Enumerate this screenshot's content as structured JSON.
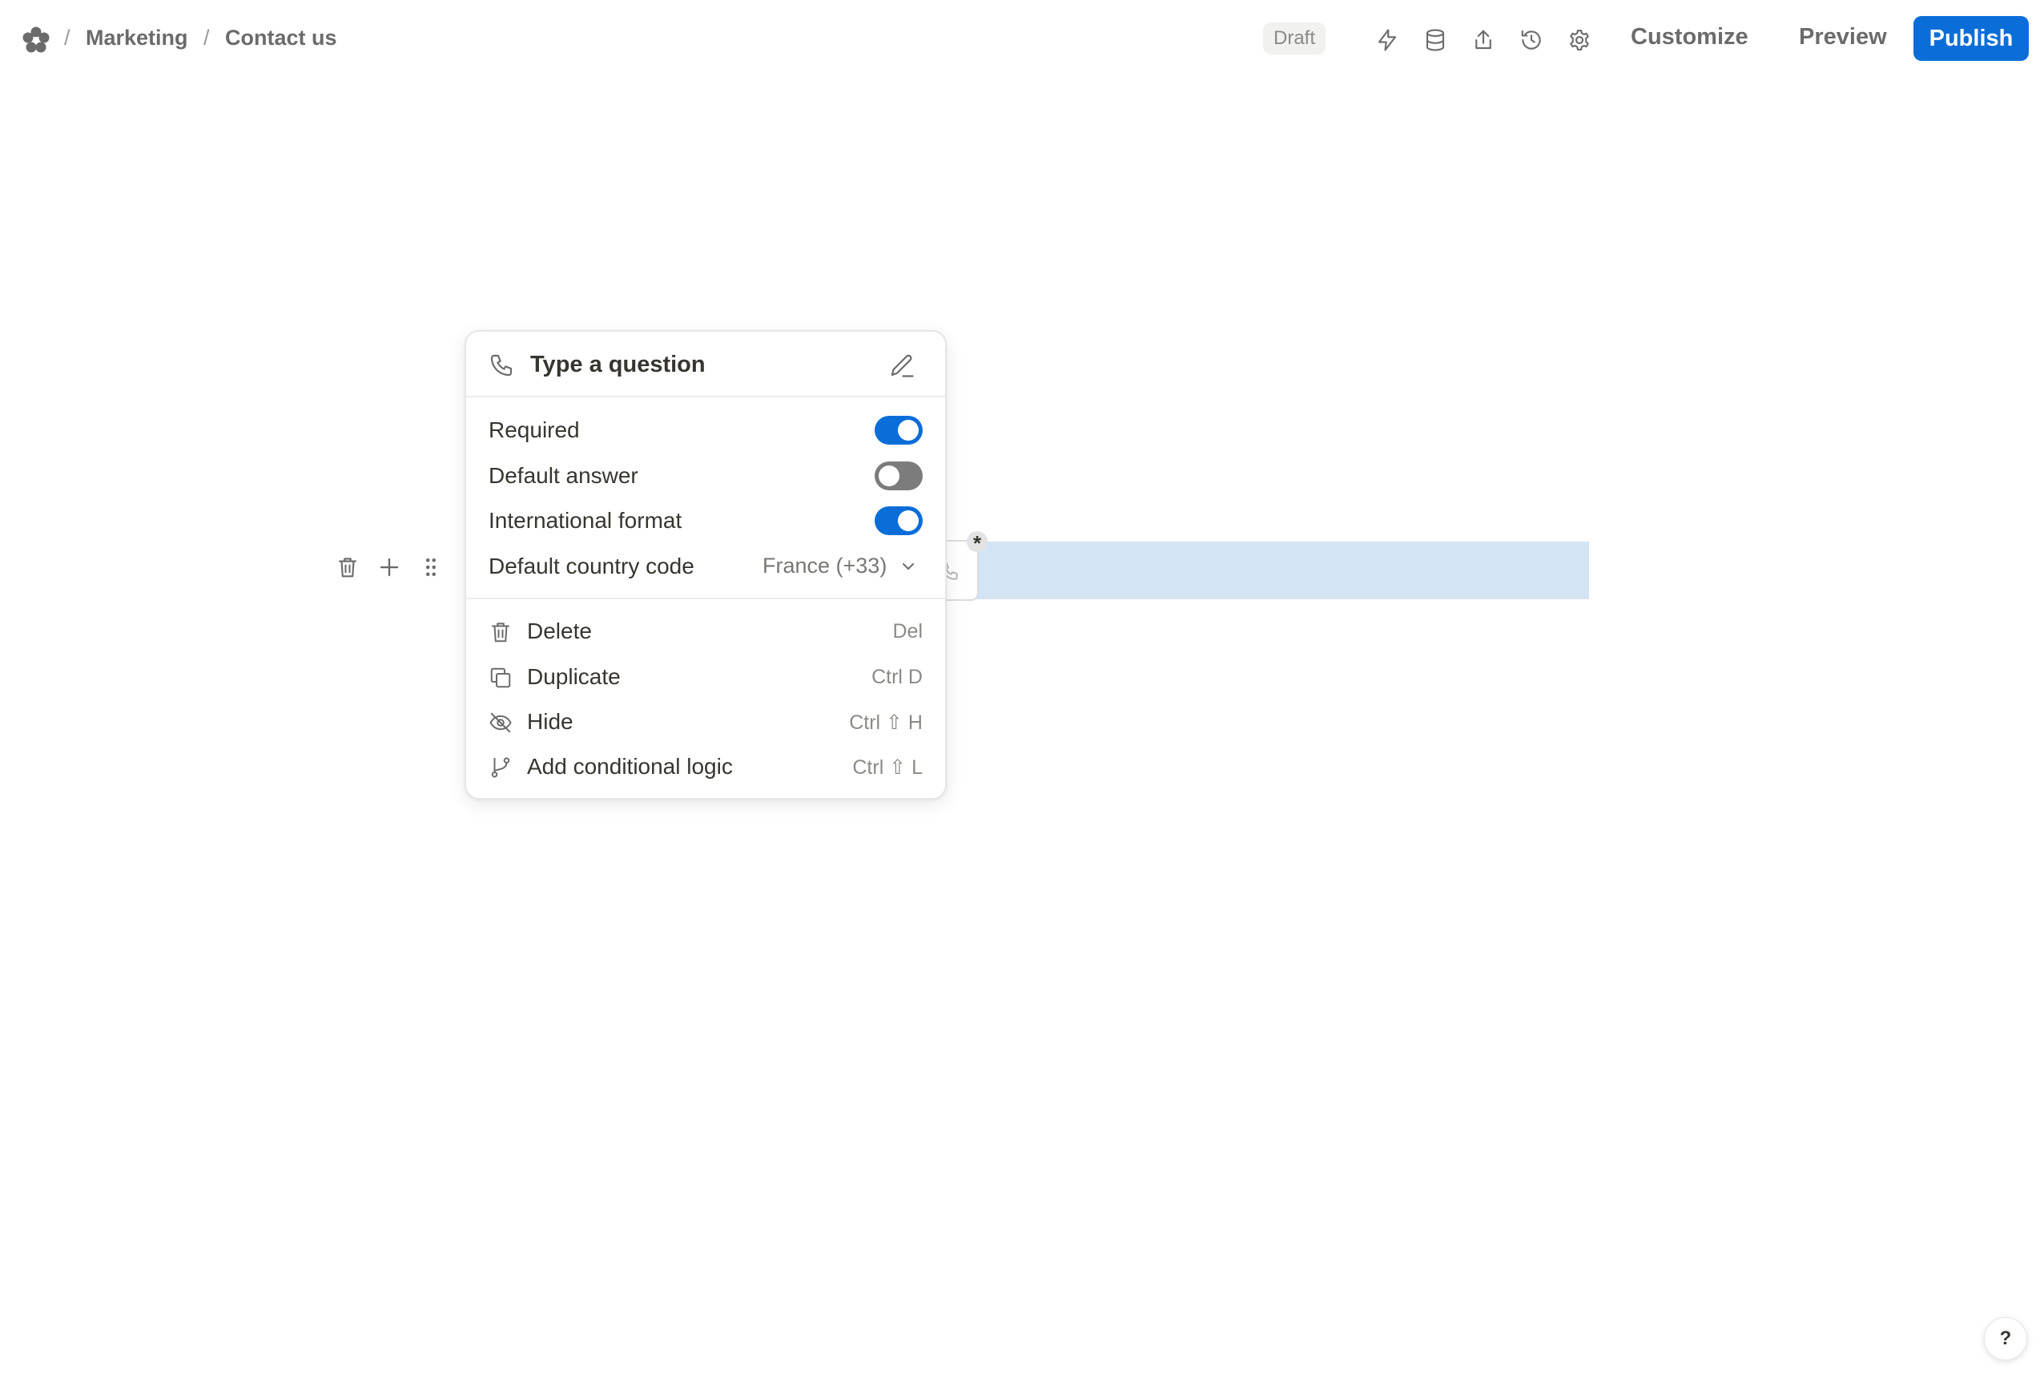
{
  "breadcrumb": {
    "separator": "/",
    "items": [
      "Marketing",
      "Contact us"
    ]
  },
  "header": {
    "status_badge": "Draft",
    "customize_label": "Customize",
    "preview_label": "Preview",
    "publish_label": "Publish",
    "icons": [
      "bolt-icon",
      "database-icon",
      "share-icon",
      "history-icon",
      "gear-icon"
    ]
  },
  "block": {
    "required_marker": "*",
    "icons": [
      "trash-icon",
      "plus-icon",
      "drag-handle-icon",
      "phone-icon"
    ]
  },
  "popup": {
    "question_placeholder": "Type a question",
    "settings": {
      "required_label": "Required",
      "required_on": true,
      "default_answer_label": "Default answer",
      "default_answer_on": false,
      "international_format_label": "International format",
      "international_format_on": true,
      "country_code_label": "Default country code",
      "country_code_value": "France (+33)"
    },
    "actions": [
      {
        "label": "Delete",
        "shortcut": "Del",
        "icon": "trash-icon"
      },
      {
        "label": "Duplicate",
        "shortcut": "Ctrl D",
        "icon": "duplicate-icon"
      },
      {
        "label": "Hide",
        "shortcut": "Ctrl ⇧ H",
        "icon": "eye-off-icon"
      },
      {
        "label": "Add conditional logic",
        "shortcut": "Ctrl ⇧ L",
        "icon": "branch-icon"
      }
    ]
  },
  "help": {
    "label": "?"
  },
  "colors": {
    "accent": "#0b6ed8",
    "highlight": "#d3e5f5",
    "toggle_off": "#7c7c7c"
  }
}
